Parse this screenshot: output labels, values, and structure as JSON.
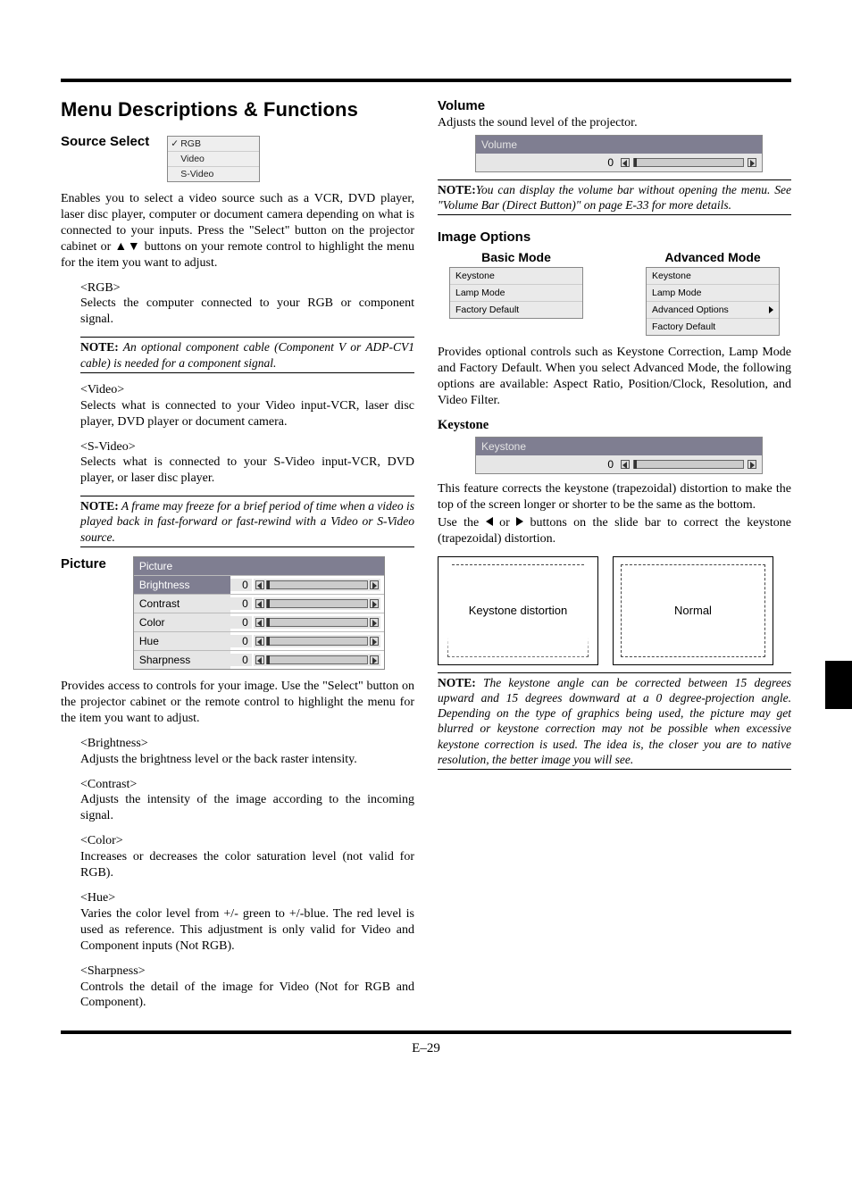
{
  "page_number": "E–29",
  "heading_main": "Menu Descriptions & Functions",
  "source_select": {
    "title": "Source Select",
    "menu": [
      "RGB",
      "Video",
      "S-Video"
    ],
    "desc": "Enables you to select a video source such as a VCR, DVD player, laser disc player, computer or document camera depending on what is connected to your inputs. Press the \"Select\" button on the projector cabinet or ▲▼ buttons on your remote control to highlight the menu for the item you want to adjust.",
    "rgb": {
      "head": "<RGB>",
      "text": "Selects the computer connected to your RGB or component signal.",
      "note_label": "NOTE:",
      "note": " An optional component cable (Component V or ADP-CV1 cable) is needed for a component signal."
    },
    "video": {
      "head": "<Video>",
      "text": "Selects what is connected to your Video input-VCR, laser disc player, DVD player or document camera."
    },
    "svideo": {
      "head": "<S-Video>",
      "text": "Selects what is connected to your S-Video input-VCR, DVD player, or laser disc player.",
      "note_label": "NOTE:",
      "note": " A frame may freeze for a brief period of time when a video is played back in fast-forward or fast-rewind with a Video or S-Video source."
    }
  },
  "picture": {
    "title": "Picture",
    "menu_header": "Picture",
    "rows": [
      {
        "label": "Brightness",
        "value": "0"
      },
      {
        "label": "Contrast",
        "value": "0"
      },
      {
        "label": "Color",
        "value": "0"
      },
      {
        "label": "Hue",
        "value": "0"
      },
      {
        "label": "Sharpness",
        "value": "0"
      }
    ],
    "desc": "Provides access to controls for your image. Use the \"Select\" button on the projector cabinet or the remote control to highlight the menu for the item you want to adjust.",
    "items": {
      "brightness": {
        "head": "<Brightness>",
        "text": "Adjusts the brightness level or the back raster intensity."
      },
      "contrast": {
        "head": "<Contrast>",
        "text": "Adjusts the intensity of the image according to the incoming signal."
      },
      "color": {
        "head": "<Color>",
        "text": "Increases or decreases the color saturation level (not valid for RGB)."
      },
      "hue": {
        "head": "<Hue>",
        "text": "Varies the color level from +/- green to +/-blue. The red level is used as reference. This adjustment is only valid for Video and Component inputs (Not RGB)."
      },
      "sharpness": {
        "head": "<Sharpness>",
        "text": "Controls the detail of the image for Video (Not for RGB and Component)."
      }
    }
  },
  "volume": {
    "title": "Volume",
    "desc": "Adjusts the sound level of the projector.",
    "panel_title": "Volume",
    "value": "0",
    "note_label": "NOTE:",
    "note": "You can display the volume bar without opening the menu. See \"Volume Bar (Direct Button)\" on page E-33 for more details."
  },
  "image_options": {
    "title": "Image Options",
    "basic_label": "Basic Mode",
    "advanced_label": "Advanced Mode",
    "basic_items": [
      "Keystone",
      "Lamp Mode",
      "Factory Default"
    ],
    "advanced_items": [
      "Keystone",
      "Lamp Mode",
      "Advanced Options",
      "Factory Default"
    ],
    "desc": "Provides optional controls such as Keystone Correction, Lamp Mode and Factory Default. When you select Advanced Mode, the following options are available: Aspect Ratio, Position/Clock, Resolution, and Video Filter."
  },
  "keystone": {
    "title": "Keystone",
    "panel_title": "Keystone",
    "value": "0",
    "p1": "This feature corrects the keystone (trapezoidal) distortion to make the top of the screen longer or shorter to be the same as the bottom.",
    "p2_pre": "Use the ",
    "p2_post": " buttons on the slide bar to correct the keystone (trapezoidal) distortion.",
    "fig1": "Keystone distortion",
    "fig2": "Normal",
    "note_label": "NOTE:",
    "note": " The keystone angle can be corrected between 15 degrees upward and 15 degrees downward at a 0 degree-projection angle. Depending on the type of graphics being used, the picture may get blurred or keystone correction may not be possible when excessive keystone correction is used. The idea is, the closer you are to native resolution, the better image you will see."
  }
}
